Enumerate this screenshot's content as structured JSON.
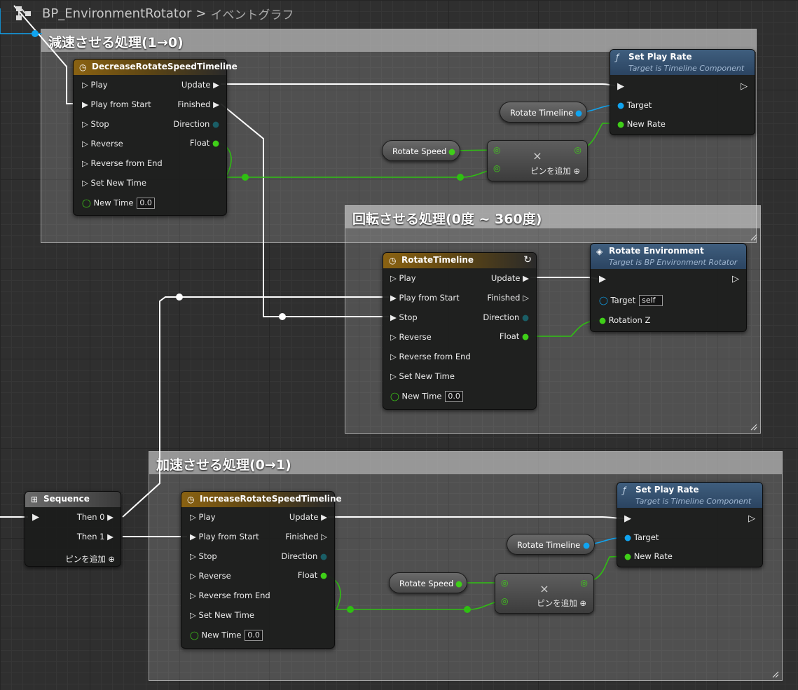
{
  "breadcrumb": {
    "blueprint": "BP_EnvironmentRotator",
    "separator": ">",
    "graph": "イベントグラフ"
  },
  "comments": {
    "decel": "減速させる処理(1→0)",
    "rotate": "回転させる処理(0度 ~ 360度)",
    "accel": "加速させる処理(0→1)"
  },
  "decrease_timeline": {
    "title": "DecreaseRotateSpeedTimeline",
    "inputs": [
      "Play",
      "Play from Start",
      "Stop",
      "Reverse",
      "Reverse from End",
      "Set New Time"
    ],
    "new_time_label": "New Time",
    "new_time_value": "0.0",
    "outputs": {
      "update": "Update",
      "finished": "Finished",
      "direction": "Direction",
      "float": "Float"
    }
  },
  "set_play_rate_top": {
    "title": "Set Play Rate",
    "subtitle": "Target is Timeline Component",
    "target": "Target",
    "new_rate": "New Rate"
  },
  "rotate_timeline_var_top": "Rotate Timeline",
  "rotate_speed_var_top": "Rotate Speed",
  "multiply_top": {
    "symbol": "×",
    "add_pin": "ピンを追加"
  },
  "rotate_timeline": {
    "title": "RotateTimeline",
    "inputs": [
      "Play",
      "Play from Start",
      "Stop",
      "Reverse",
      "Reverse from End",
      "Set New Time"
    ],
    "new_time_label": "New Time",
    "new_time_value": "0.0",
    "outputs": {
      "update": "Update",
      "finished": "Finished",
      "direction": "Direction",
      "float": "Float"
    }
  },
  "rotate_environment": {
    "title": "Rotate Environment",
    "subtitle": "Target is BP Environment Rotator",
    "target": "Target",
    "target_value": "self",
    "rotation": "Rotation Z"
  },
  "sequence": {
    "title": "Sequence",
    "then0": "Then 0",
    "then1": "Then 1",
    "add_pin": "ピンを追加"
  },
  "increase_timeline": {
    "title": "IncreaseRotateSpeedTimeline",
    "inputs": [
      "Play",
      "Play from Start",
      "Stop",
      "Reverse",
      "Reverse from End",
      "Set New Time"
    ],
    "new_time_label": "New Time",
    "new_time_value": "0.0",
    "outputs": {
      "update": "Update",
      "finished": "Finished",
      "direction": "Direction",
      "float": "Float"
    }
  },
  "set_play_rate_bottom": {
    "title": "Set Play Rate",
    "subtitle": "Target is Timeline Component",
    "target": "Target",
    "new_rate": "New Rate"
  },
  "rotate_timeline_var_bottom": "Rotate Timeline",
  "rotate_speed_var_bottom": "Rotate Speed",
  "multiply_bottom": {
    "symbol": "×",
    "add_pin": "ピンを追加"
  },
  "colors": {
    "exec": "#ffffff",
    "float": "#3fcf18",
    "object": "#10a4f0",
    "timeline_header": "#8a6212",
    "function_header": "#3f5e7e"
  },
  "icons": [
    "blueprint-graph-icon",
    "clock-icon",
    "function-icon",
    "loop-icon",
    "event-diamond-icon",
    "sequence-icon",
    "add-pin-icon"
  ]
}
